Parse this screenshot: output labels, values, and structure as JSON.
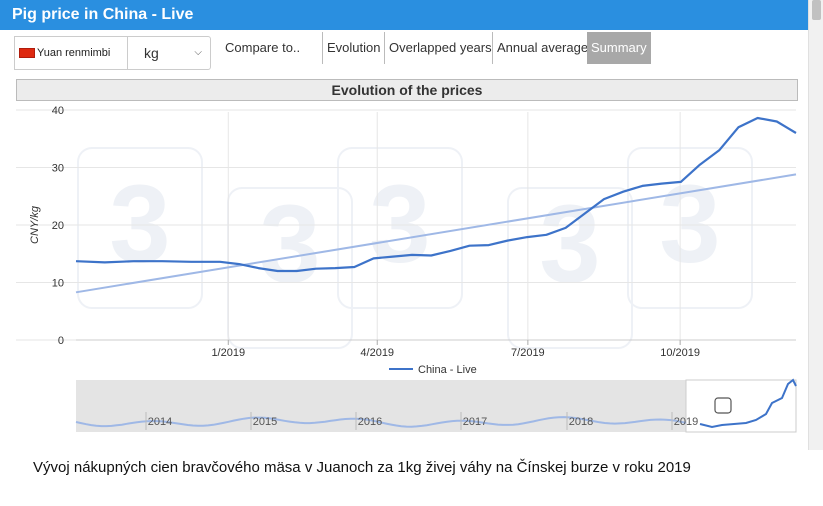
{
  "header": {
    "title": "Pig price in China - Live"
  },
  "toolbar": {
    "currency": "Yuan renmimbi",
    "unit": "kg",
    "compare": "Compare to..",
    "tabs": [
      {
        "label": "Evolution",
        "active": false
      },
      {
        "label": "Overlapped years",
        "active": false
      },
      {
        "label": "Annual average",
        "active": false
      },
      {
        "label": "Summary",
        "active": true
      }
    ]
  },
  "panel": {
    "title": "Evolution of the prices"
  },
  "chart_data": {
    "type": "line",
    "title": "Evolution of the prices",
    "ylabel": "CNY/kg",
    "xlabel": "",
    "ylim": [
      0,
      40
    ],
    "yticks": [
      0,
      10,
      20,
      30,
      40
    ],
    "xticks": [
      "1/2019",
      "4/2019",
      "7/2019",
      "10/2019"
    ],
    "xlim": [
      "2018-10-01",
      "2019-12-10"
    ],
    "grid": true,
    "legend": "bottom-center",
    "series": [
      {
        "name": "China - Live",
        "color": "#3d73c9",
        "points": [
          [
            "2018-10-01",
            13.7
          ],
          [
            "2018-10-22",
            13.5
          ],
          [
            "2018-11-12",
            13.7
          ],
          [
            "2018-12-03",
            13.7
          ],
          [
            "2018-12-24",
            13.6
          ],
          [
            "2019-01-14",
            13.6
          ],
          [
            "2019-01-28",
            13.2
          ],
          [
            "2019-02-11",
            12.5
          ],
          [
            "2019-02-25",
            12.0
          ],
          [
            "2019-03-11",
            12.0
          ],
          [
            "2019-03-25",
            12.4
          ],
          [
            "2019-04-08",
            12.5
          ],
          [
            "2019-04-22",
            12.7
          ],
          [
            "2019-05-06",
            14.2
          ],
          [
            "2019-05-20",
            14.5
          ],
          [
            "2019-06-03",
            14.8
          ],
          [
            "2019-06-17",
            14.7
          ],
          [
            "2019-07-01",
            15.5
          ],
          [
            "2019-07-15",
            16.4
          ],
          [
            "2019-07-29",
            16.5
          ],
          [
            "2019-08-12",
            17.3
          ],
          [
            "2019-08-26",
            17.9
          ],
          [
            "2019-09-09",
            18.3
          ],
          [
            "2019-09-23",
            19.5
          ],
          [
            "2019-10-07",
            22.0
          ],
          [
            "2019-10-21",
            24.5
          ],
          [
            "2019-11-04",
            25.8
          ],
          [
            "2019-11-18",
            26.8
          ],
          [
            "2019-12-02",
            27.2
          ],
          [
            "2019-12-16",
            27.5
          ],
          [
            "2019-12-30",
            30.5
          ],
          [
            "2020-01-13",
            33.0
          ],
          [
            "2020-01-27",
            37.0
          ],
          [
            "2020-02-10",
            38.6
          ],
          [
            "2020-02-24",
            38.0
          ],
          [
            "2020-03-09",
            36.0
          ]
        ]
      },
      {
        "name": "trend",
        "color": "#9fb8e6",
        "points": [
          [
            "2018-10-01",
            8.3
          ],
          [
            "2020-03-09",
            28.8
          ]
        ]
      }
    ],
    "navigator": {
      "labels": [
        "2014",
        "2015",
        "2016",
        "2017",
        "2018",
        "2019"
      ]
    }
  },
  "caption": "Vývoj nákupných cien bravčového mäsa v Juanoch za 1kg živej váhy na Čínskej burze v roku 2019"
}
